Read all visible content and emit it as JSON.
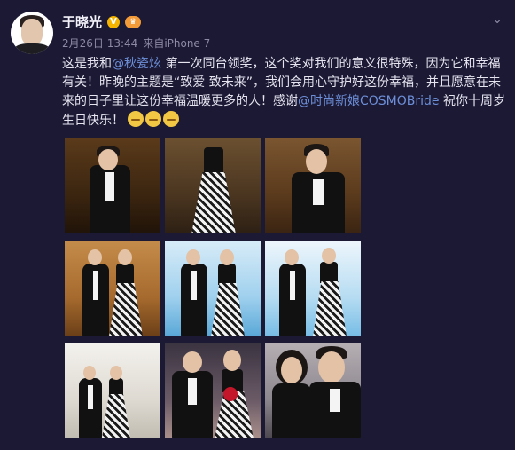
{
  "user": {
    "name": "于晓光",
    "date": "2月26日 13:44",
    "source": "来自iPhone 7"
  },
  "post": {
    "p1": "这是我和",
    "mention1": "@秋瓷炫",
    "p2": " 第一次同台领奖，这个奖对我们的意义很特殊，因为它和幸福有关！昨晚的主题是“致爱 致未来”，我们会用心守护好这份幸福，并且愿意在未来的日子里让这份幸福温暖更多的人！感谢",
    "mention2": "@时尚新娘COSMOBride",
    "p3": " 祝你十周岁生日快乐！"
  },
  "icons": {
    "verified": "verified-v-icon",
    "level": "member-level-icon",
    "more": "chevron-down-icon",
    "emoji": "smiling-face-emoji"
  },
  "colors": {
    "background": "#1b1934",
    "mention": "#6d8fd8",
    "meta": "#8e8aa6"
  }
}
